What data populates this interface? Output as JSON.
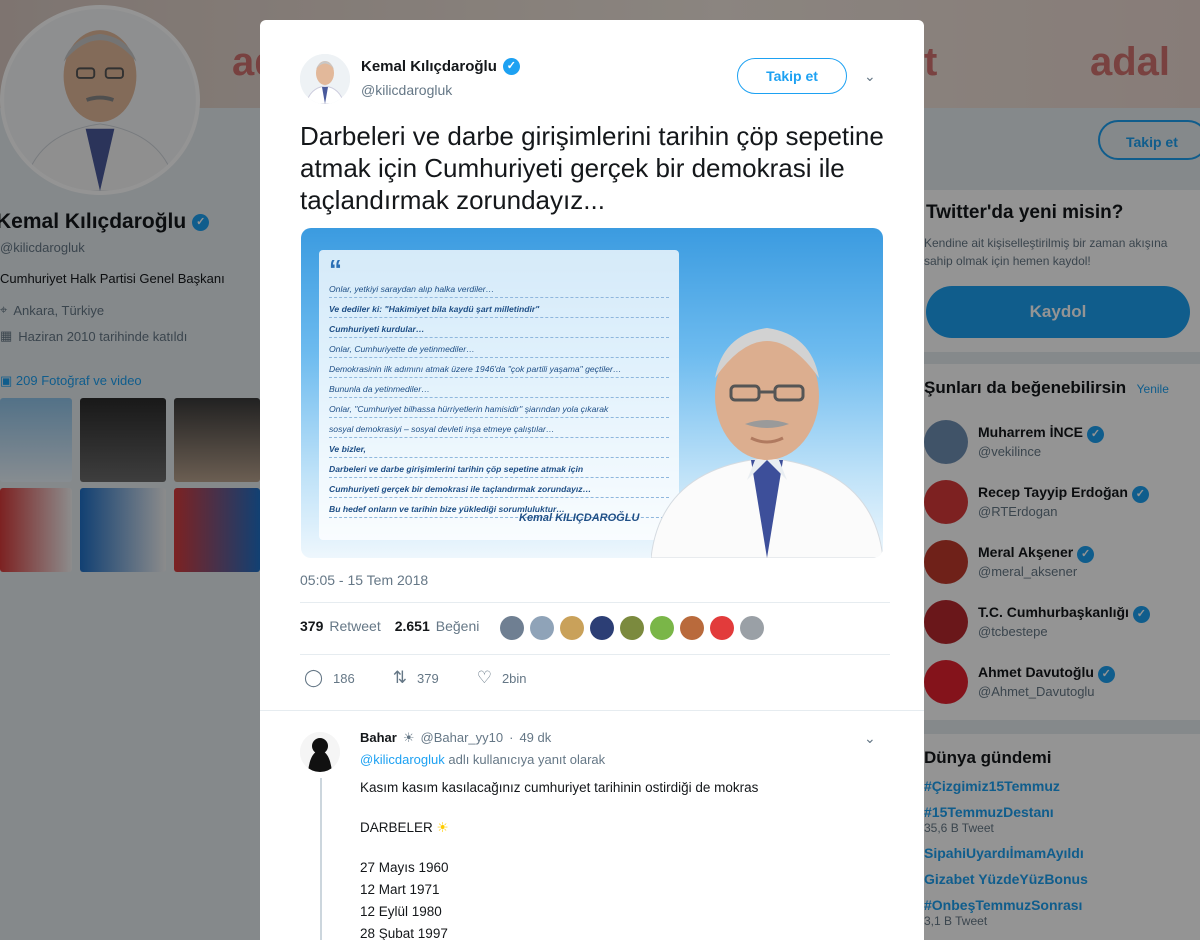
{
  "profile": {
    "name": "Kemal Kılıçdaroğlu",
    "handle": "@kilicdarogluk",
    "bio": "Cumhuriyet Halk Partisi Genel Başkanı",
    "location": "Ankara, Türkiye",
    "joined": "Haziran 2010 tarihinde katıldı",
    "media": "209 Fotoğraf ve video",
    "banner_text_left": "ada",
    "banner_text_mid": "t",
    "banner_text_right": "adal",
    "follow_label": "Takip et"
  },
  "signup": {
    "title": "Twitter'da yeni misin?",
    "desc": "Kendine ait kişiselleştirilmiş bir zaman akışına sahip olmak için hemen kaydol!",
    "button": "Kaydol"
  },
  "suggestions": {
    "title": "Şunları da beğenebilirsin",
    "view_all": "Yenile",
    "items": [
      {
        "name": "Muharrem İNCE",
        "handle": "@vekilince",
        "color": "#6f8fb3"
      },
      {
        "name": "Recep Tayyip Erdoğan",
        "handle": "@RTErdogan",
        "color": "#d83a3a"
      },
      {
        "name": "Meral Akşener",
        "handle": "@meral_aksener",
        "color": "#c0392b"
      },
      {
        "name": "T.C. Cumhurbaşkanlığı",
        "handle": "@tcbestepe",
        "color": "#b7282e"
      },
      {
        "name": "Ahmet Davutoğlu",
        "handle": "@Ahmet_Davutoglu",
        "color": "#e3222f"
      }
    ]
  },
  "trends": {
    "title": "Dünya gündemi",
    "items": [
      {
        "tag": "#Çizgimiz15Temmuz",
        "sub": ""
      },
      {
        "tag": "#15TemmuzDestanı",
        "sub": "35,6 B Tweet"
      },
      {
        "tag": "SipahiUyardıİmamAyıldı",
        "sub": ""
      },
      {
        "tag": "Gizabet YüzdeYüzBonus",
        "sub": ""
      },
      {
        "tag": "#OnbeşTemmuzSonrası",
        "sub": "3,1 B Tweet"
      }
    ]
  },
  "tweet": {
    "author": "Kemal Kılıçdaroğlu",
    "handle": "@kilicdarogluk",
    "follow_label": "Takip et",
    "text": "Darbeleri ve darbe girişimlerini tarihin çöp sepetine atmak için Cumhuriyeti gerçek bir demokrasi ile taçlandırmak zorundayız...",
    "timestamp": "05:05 - 15 Tem 2018",
    "retweets_count": "379",
    "retweets_label": "Retweet",
    "likes_count": "2.651",
    "likes_label": "Beğeni",
    "reply_action": "186",
    "retweet_action": "379",
    "like_action": "2bin",
    "image_quote_mark": "“",
    "image_lines": [
      {
        "text": "Onlar, yetkiyi saraydan alıp halka verdiler…",
        "bold": false
      },
      {
        "text": "Ve dediler ki: \"Hakimiyet bila kaydü şart milletindir\"",
        "bold": true
      },
      {
        "text": "Cumhuriyeti kurdular…",
        "bold": true
      },
      {
        "text": "Onlar, Cumhuriyette de yetinmediler…",
        "bold": false
      },
      {
        "text": "Demokrasinin ilk adımını atmak üzere 1946'da \"çok partili yaşama\" geçtiler…",
        "bold": false
      },
      {
        "text": "Bununla da yetinmediler…",
        "bold": false
      },
      {
        "text": "Onlar, \"Cumhuriyet bilhassa hürriyetlerin hamisidir\" şiarından yola çıkarak",
        "bold": false
      },
      {
        "text": "sosyal demokrasiyi – sosyal devleti inşa etmeye çalıştılar…",
        "bold": false
      },
      {
        "text": "Ve bizler,",
        "bold": true
      },
      {
        "text": "Darbeleri ve darbe girişimlerini tarihin çöp sepetine atmak için",
        "bold": true
      },
      {
        "text": "Cumhuriyeti gerçek bir demokrasi ile taçlandırmak zorundayız…",
        "bold": true
      },
      {
        "text": "Bu hedef onların ve tarihin bize yüklediği sorumluluktur…",
        "bold": true
      }
    ],
    "image_signature": "Kemal KILIÇDAROĞLU",
    "likers": [
      "#6f7f92",
      "#8fa3b8",
      "#c9a15a",
      "#2c3e75",
      "#7b8a3e",
      "#7ab648",
      "#b96a3c",
      "#e23b3b",
      "#9aa0a6"
    ]
  },
  "reply": {
    "name": "Bahar",
    "handle": "@Bahar_yy10",
    "time": "49 dk",
    "replying_prefix": "",
    "replying_user": "@kilicdarogluk",
    "replying_suffix": "adlı kullanıcıya yanıt olarak",
    "line1": "Kasım kasım kasılacağınız cumhuriyet tarihinin ostirdiği de mokras",
    "line2": "DARBELER",
    "dates": [
      "27 Mayıs 1960",
      "12 Mart 1971",
      "12 Eylül 1980",
      "28 Şubat 1997"
    ]
  }
}
